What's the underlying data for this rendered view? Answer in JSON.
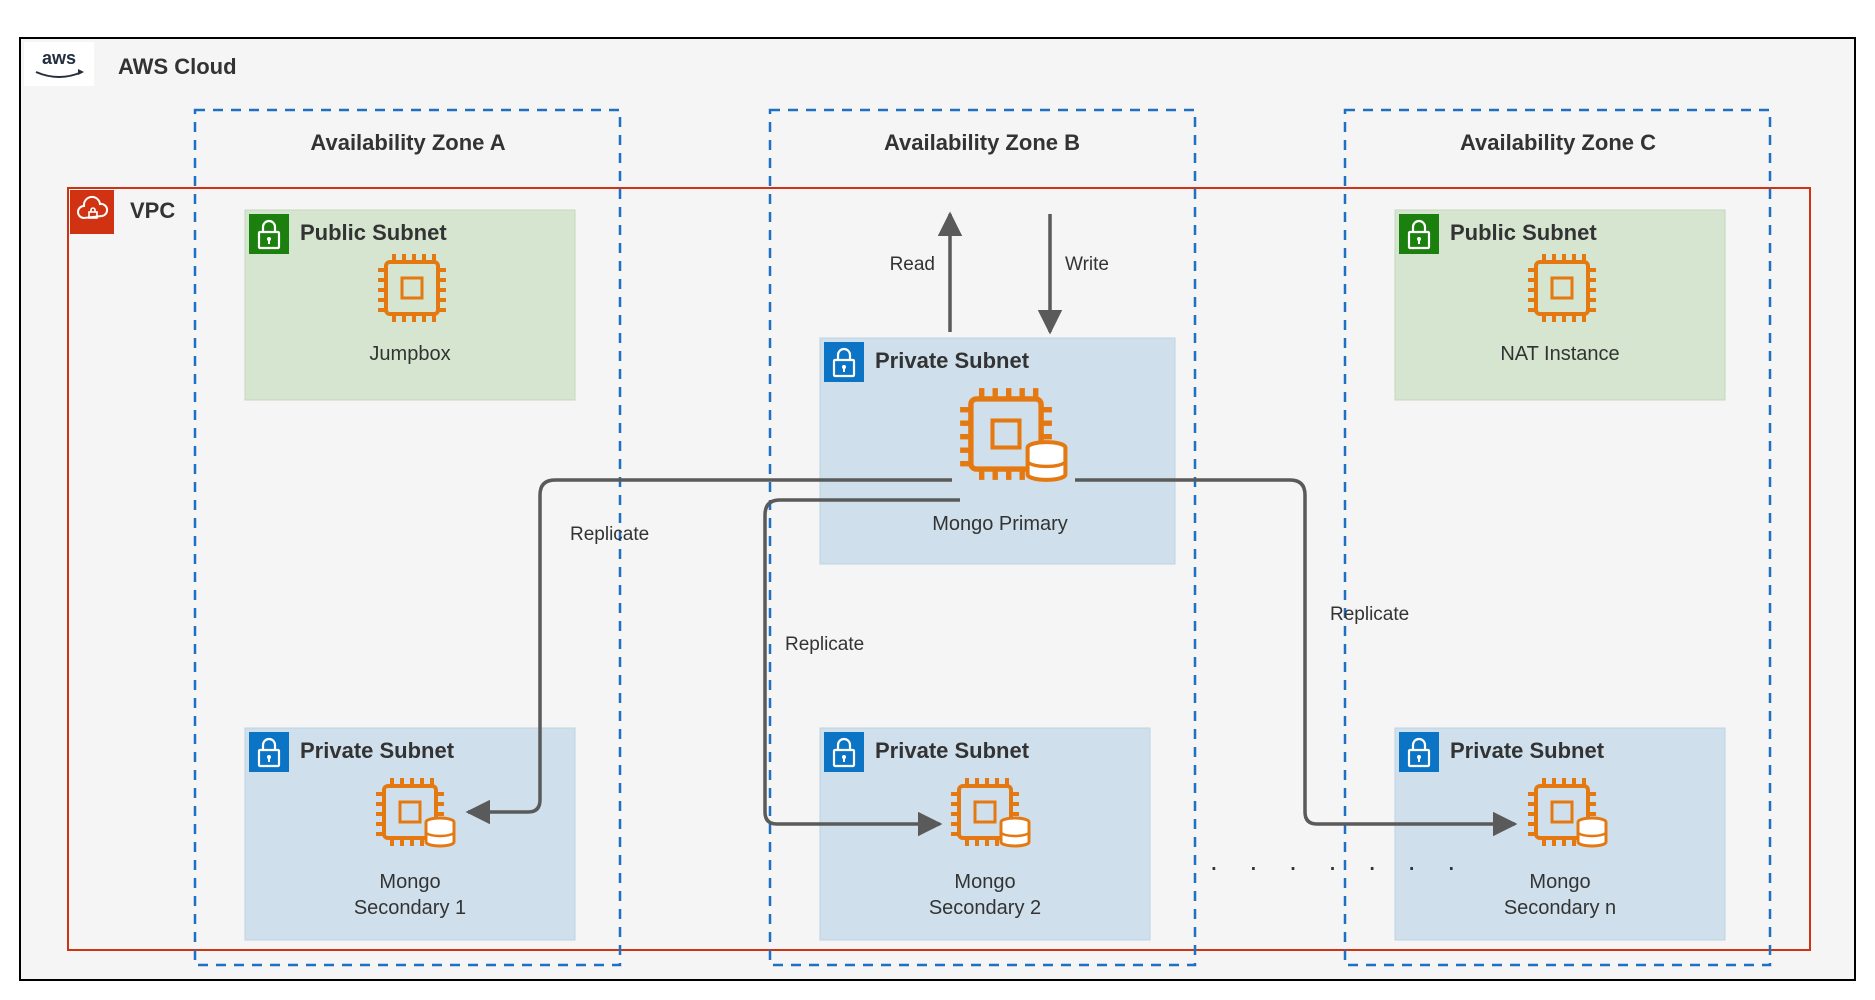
{
  "cloud": {
    "label": "AWS Cloud"
  },
  "vpc": {
    "label": "VPC"
  },
  "zones": {
    "a": "Availability Zone A",
    "b": "Availability Zone B",
    "c": "Availability Zone C"
  },
  "subnets": {
    "public_a": {
      "title": "Public Subnet",
      "node": "Jumpbox"
    },
    "public_c": {
      "title": "Public Subnet",
      "node": "NAT Instance"
    },
    "private_b_top": {
      "title": "Private Subnet",
      "node": "Mongo Primary"
    },
    "private_a_bot": {
      "title": "Private Subnet",
      "node_l1": "Mongo",
      "node_l2": "Secondary 1"
    },
    "private_b_bot": {
      "title": "Private Subnet",
      "node_l1": "Mongo",
      "node_l2": "Secondary 2"
    },
    "private_c_bot": {
      "title": "Private Subnet",
      "node_l1": "Mongo",
      "node_l2": "Secondary n"
    }
  },
  "edges": {
    "read": "Read",
    "write": "Write",
    "repl_a": "Replicate",
    "repl_b": "Replicate",
    "repl_c": "Replicate"
  },
  "ellipsis": ". . . . . . ."
}
